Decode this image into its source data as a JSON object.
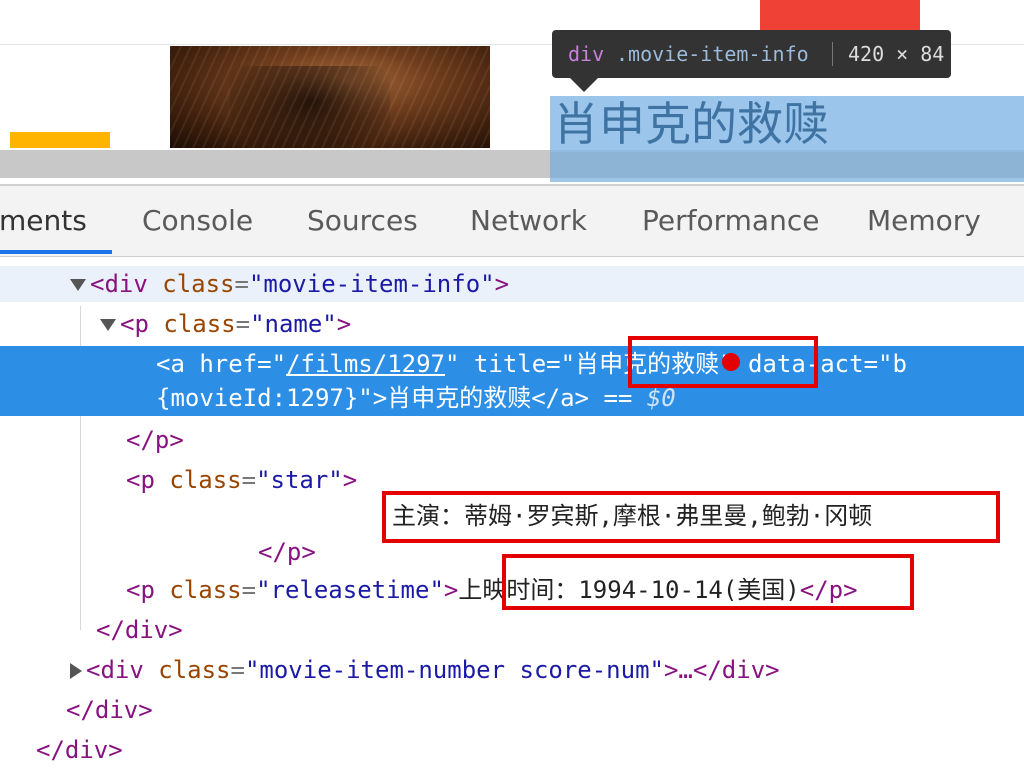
{
  "tooltip": {
    "tag": "div",
    "selector": ".movie-item-info",
    "size": "420 × 84"
  },
  "preview": {
    "highlighted_title": "肖申克的救赎"
  },
  "tabs": [
    {
      "label": "ments",
      "active": true
    },
    {
      "label": "Console"
    },
    {
      "label": "Sources"
    },
    {
      "label": "Network"
    },
    {
      "label": "Performance"
    },
    {
      "label": "Memory"
    }
  ],
  "dom": {
    "l1": {
      "tag_open": "<div",
      "attr": "class",
      "value": "\"movie-item-info\"",
      "close": ">"
    },
    "l2": {
      "tag_open": "<p",
      "attr": "class",
      "value": "\"name\"",
      "close": ">"
    },
    "l3": {
      "tag_open": "<a",
      "href_attr": "href",
      "href_val": "/films/1297",
      "title_attr": "title",
      "title_val": "肖申克的救赎",
      "act_attr": "data-act",
      "act_val": "\"b"
    },
    "l3b": {
      "val": "{movieId:1297}\"",
      "text": "肖申克的救赎",
      "end": "</a>",
      "eq": "==",
      "dollar": "$0"
    },
    "l4": {
      "tag": "</p>"
    },
    "l5": {
      "tag_open": "<p",
      "attr": "class",
      "value": "\"star\"",
      "close": ">"
    },
    "l6": {
      "text": "主演：蒂姆·罗宾斯,摩根·弗里曼,鲍勃·冈顿"
    },
    "l7": {
      "tag": "</p>"
    },
    "l8": {
      "tag_open": "<p",
      "attr": "class",
      "value": "\"releasetime\"",
      "close": ">",
      "text": "上映时间：1994-10-14(美国)",
      "end": "</p>"
    },
    "l9": {
      "tag": "</div>"
    },
    "l10": {
      "tag_open": "<div",
      "attr": "class",
      "value": "\"movie-item-number score-num\"",
      "close": ">…",
      "end": "</div>"
    },
    "l11": {
      "tag": "</div>"
    },
    "l12": {
      "tag": "</div>"
    }
  }
}
